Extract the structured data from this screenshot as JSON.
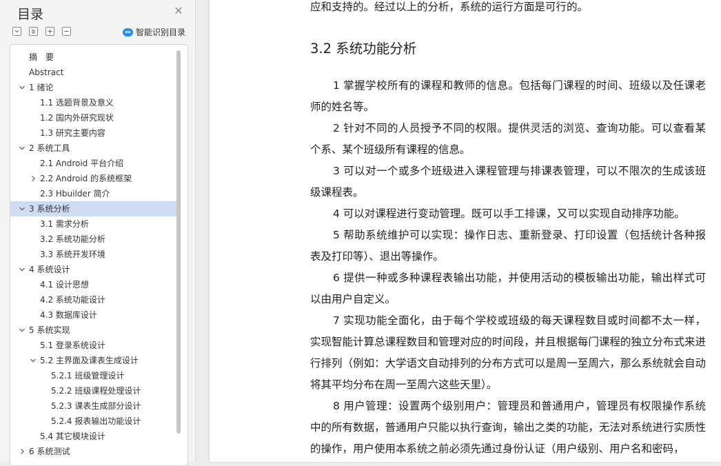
{
  "toc": {
    "title": "目录",
    "close_icon": "close-icon",
    "tools": [
      "collapse-all-icon",
      "expand-all-icon",
      "plus-icon",
      "minus-icon"
    ],
    "ai_button_label": "智能识别目录",
    "accent": "#2d8cf0",
    "active_bg": "#cfdcf3",
    "items": [
      {
        "label": "摘　要",
        "level": 0,
        "chev": ""
      },
      {
        "label": "Abstract",
        "level": 0,
        "chev": ""
      },
      {
        "label": "1 绪论",
        "level": 0,
        "chev": "v"
      },
      {
        "label": "1.1 选题背景及意义",
        "level": 1,
        "chev": ""
      },
      {
        "label": "1.2 国内外研究现状",
        "level": 1,
        "chev": ""
      },
      {
        "label": "1.3 研究主要内容",
        "level": 1,
        "chev": ""
      },
      {
        "label": "2 系统工具",
        "level": 0,
        "chev": "v"
      },
      {
        "label": "2.1 Android 平台介绍",
        "level": 1,
        "chev": ""
      },
      {
        "label": "2.2 Android 的系统框架",
        "level": 1,
        "chev": ">"
      },
      {
        "label": "2.3 Hbuilder 简介",
        "level": 1,
        "chev": ""
      },
      {
        "label": "3 系统分析",
        "level": 0,
        "chev": "v",
        "active": true
      },
      {
        "label": "3.1 需求分析",
        "level": 1,
        "chev": ""
      },
      {
        "label": "3.2 系统功能分析",
        "level": 1,
        "chev": ""
      },
      {
        "label": "3.3 系统开发环境",
        "level": 1,
        "chev": ""
      },
      {
        "label": "4 系统设计",
        "level": 0,
        "chev": "v"
      },
      {
        "label": "4.1 设计思想",
        "level": 1,
        "chev": ""
      },
      {
        "label": "4.2 系统功能设计",
        "level": 1,
        "chev": ""
      },
      {
        "label": "4.3 数据库设计",
        "level": 1,
        "chev": ""
      },
      {
        "label": "5 系统实现",
        "level": 0,
        "chev": "v"
      },
      {
        "label": "5.1 登录系统设计",
        "level": 1,
        "chev": ""
      },
      {
        "label": "5.2 主界面及课表生成设计",
        "level": 1,
        "chev": "v"
      },
      {
        "label": "5.2.1 班级管理设计",
        "level": 2,
        "chev": ""
      },
      {
        "label": "5.2.2 班级课程处理设计",
        "level": 2,
        "chev": ""
      },
      {
        "label": "5.2.3 课表生成部分设计",
        "level": 2,
        "chev": ""
      },
      {
        "label": "5.2.4 报表输出功能设计",
        "level": 2,
        "chev": ""
      },
      {
        "label": "5.4 其它模块设计",
        "level": 1,
        "chev": ""
      },
      {
        "label": "6 系统测试",
        "level": 0,
        "chev": ">"
      }
    ]
  },
  "doc": {
    "intro": "应和支持的。经过以上的分析，系统的运行方面是可行的。",
    "heading": "3.2 系统功能分析",
    "paragraphs": [
      "1 掌握学校所有的课程和教师的信息。包括每门课程的时间、班级以及任课老师的姓名等。",
      "2 针对不同的人员授予不同的权限。提供灵活的浏览、查询功能。可以查看某个系、某个班级所有课程的信息。",
      "3 可以对一个或多个班级进入课程管理与排课表管理，可以不限次的生成该班级课程表。",
      "4 可以对课程进行变动管理。既可以手工排课，又可以实现自动排序功能。",
      "5 帮助系统维护可以实现：操作日志、重新登录、打印设置（包括统计各种报表及打印等）、退出等操作。",
      "6 提供一种或多种课程表输出功能，并使用活动的模板输出功能，输出样式可以由用户自定义。",
      "7 实现功能全面化，由于每个学校或班级的每天课程数目或时间都不太一样，实现智能计算总课程数目和管理对应的时间段，并且根据每门课程的独立分布式来进行排列（例如：大学语文自动排列的分布方式可以是周一至周六，那么系统就会自动将其平均分布在周一至周六这些天里）。",
      "8 用户管理：设置两个级别用户：管理员和普通用户，管理员有权限操作系统中的所有数据，普通用户只能以执行查询，输出之类的功能，无法对系统进行实质性的操作，用户使用本系统之前必须先通过身份认证（用户级别、用户名和密码，"
    ]
  }
}
